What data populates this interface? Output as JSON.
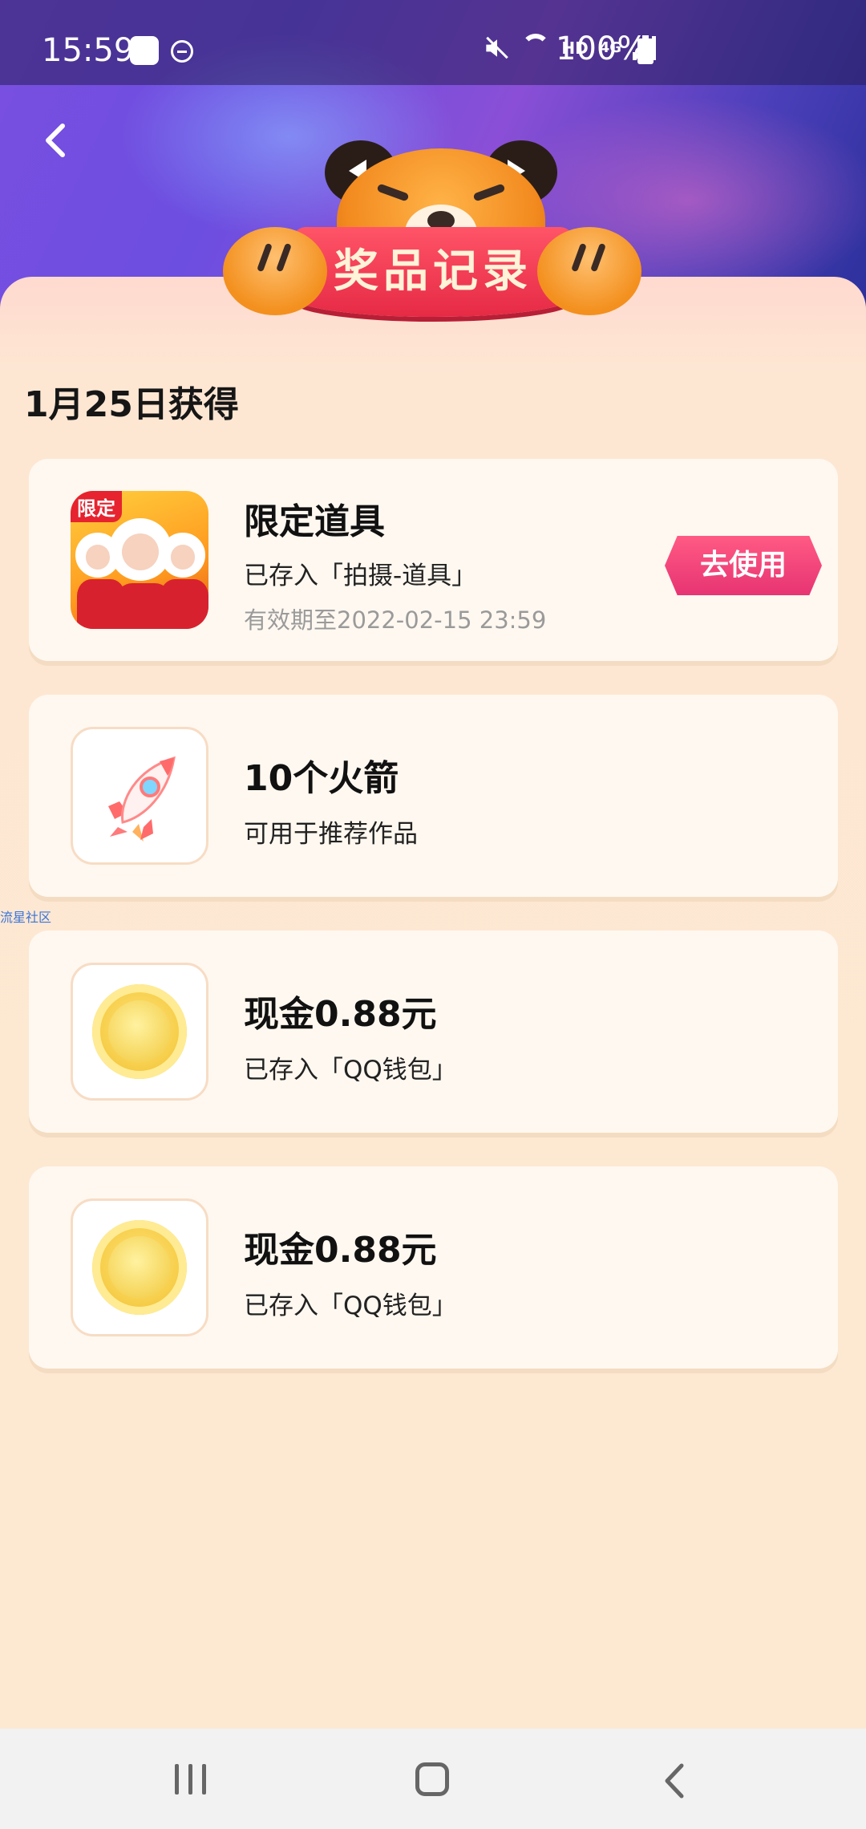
{
  "status_bar": {
    "time": "15:59",
    "network_label": "HD",
    "network_type": "4G",
    "battery": "100%"
  },
  "header": {
    "banner_title": "奖品记录"
  },
  "section": {
    "date_title": "1月25日获得"
  },
  "prizes": [
    {
      "title": "限定道具",
      "subtitle": "已存入「拍摄-道具」",
      "expiry": "有效期至2022-02-15 23:59",
      "button_label": "去使用",
      "thumb_tag": "限定",
      "icon": "prop-thumbnail"
    },
    {
      "title": "10个火箭",
      "subtitle": "可用于推荐作品",
      "icon": "rocket-icon"
    },
    {
      "title": "现金0.88元",
      "subtitle": "已存入「QQ钱包」",
      "icon": "coin-icon"
    },
    {
      "title": "现金0.88元",
      "subtitle": "已存入「QQ钱包」",
      "icon": "coin-icon"
    }
  ],
  "watermark": "流星社区",
  "colors": {
    "accent": "#e73473",
    "banner": "#e62a45",
    "background": "#fde8d2",
    "card": "#fff8f0"
  }
}
